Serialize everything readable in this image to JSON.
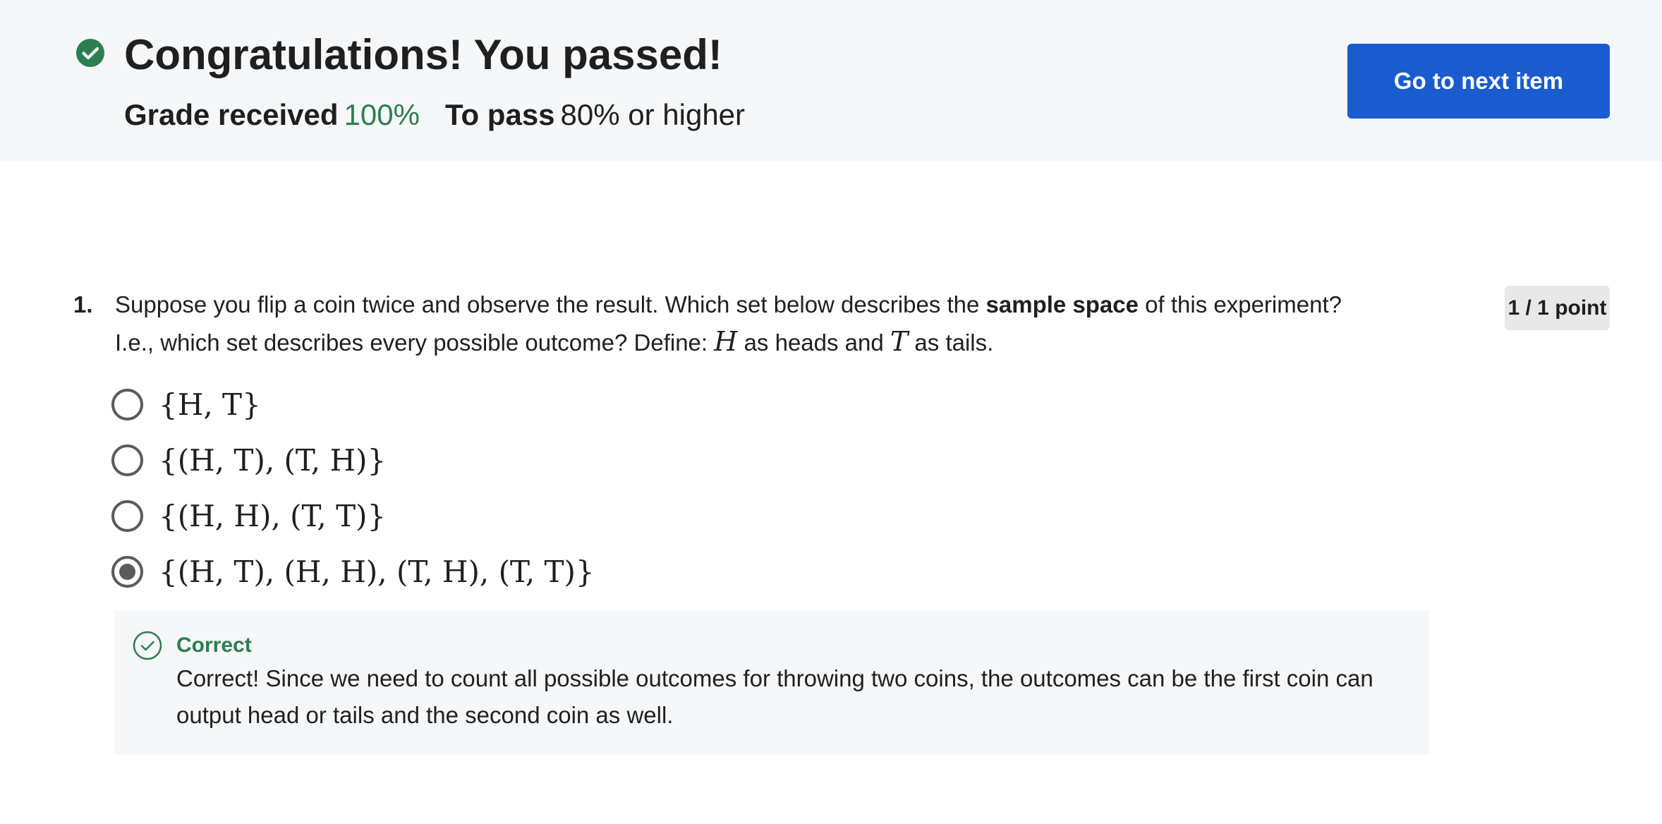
{
  "header": {
    "title": "Congratulations! You passed!",
    "grade_label": "Grade received",
    "grade_value": "100%",
    "pass_label": "To pass",
    "pass_value": "80% or higher",
    "next_button": "Go to next item",
    "accent_color": "#1a5bd0",
    "success_color": "#2e7d4f",
    "icon": "check-circle-filled-icon"
  },
  "question": {
    "number": "1.",
    "text_before_bold": "Suppose you flip a coin twice and observe the result. Which set below describes the ",
    "text_bold": "sample space",
    "text_after_bold": " of this experiment? I.e., which set describes every possible outcome? Define: ",
    "var_h": "H",
    "text_mid": " as heads and ",
    "var_t": "T",
    "text_end": " as tails.",
    "points": "1 / 1 point",
    "options": [
      {
        "label": "{H, T}",
        "selected": false
      },
      {
        "label": "{(H, T), (T, H)}",
        "selected": false
      },
      {
        "label": "{(H, H), (T, T)}",
        "selected": false
      },
      {
        "label": "{(H, T), (H, H), (T, H), (T, T)}",
        "selected": true
      }
    ],
    "feedback": {
      "title": "Correct",
      "text": "Correct! Since we need to count all possible outcomes for throwing two coins, the outcomes can be the first coin can output head or tails and the second coin as well.",
      "icon": "check-circle-outline-icon"
    }
  }
}
